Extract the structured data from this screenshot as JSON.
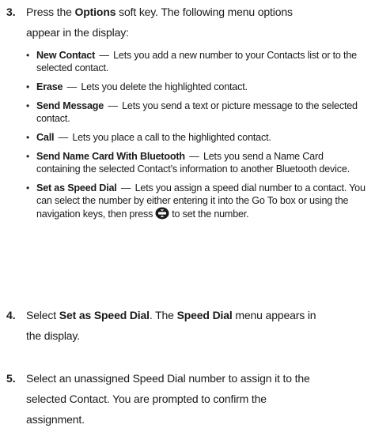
{
  "steps": [
    {
      "number": "3.",
      "line1_pre": "Press the ",
      "line1_bold": "Options",
      "line1_post": " soft key. The following menu options",
      "line2": "appear in the display:"
    },
    {
      "number": "4.",
      "pre": "Select ",
      "bold1": "Set as Speed Dial",
      "mid": ". The ",
      "bold2": "Speed Dial",
      "post": " menu appears in",
      "line2": "the display."
    },
    {
      "number": "5.",
      "line1": "Select an unassigned Speed Dial number to assign it to the",
      "line2": "selected Contact. You are prompted to confirm the",
      "line3": "assignment."
    }
  ],
  "bullet_char": "•",
  "dash_char": "—",
  "options": [
    {
      "name": "New Contact",
      "desc": "Lets you add a new number to your Contacts list or to the selected contact."
    },
    {
      "name": "Erase",
      "desc": "Lets you delete the highlighted contact."
    },
    {
      "name": "Send Message",
      "desc": "Lets you send a text or picture message to the selected contact."
    },
    {
      "name": "Call",
      "desc": "Lets you place a call to the highlighted contact."
    },
    {
      "name": "Send Name Card With Bluetooth",
      "desc": "Lets you send a Name Card containing the selected Contact’s information to another Bluetooth device."
    },
    {
      "name": "Set as Speed Dial",
      "desc_pre": "Lets you assign a speed dial number to a contact. You can select the number by either entering it into the Go To box or using the navigation keys, then press",
      "desc_icon": "nav-ok-key-icon",
      "desc_post": "to set the number."
    }
  ]
}
